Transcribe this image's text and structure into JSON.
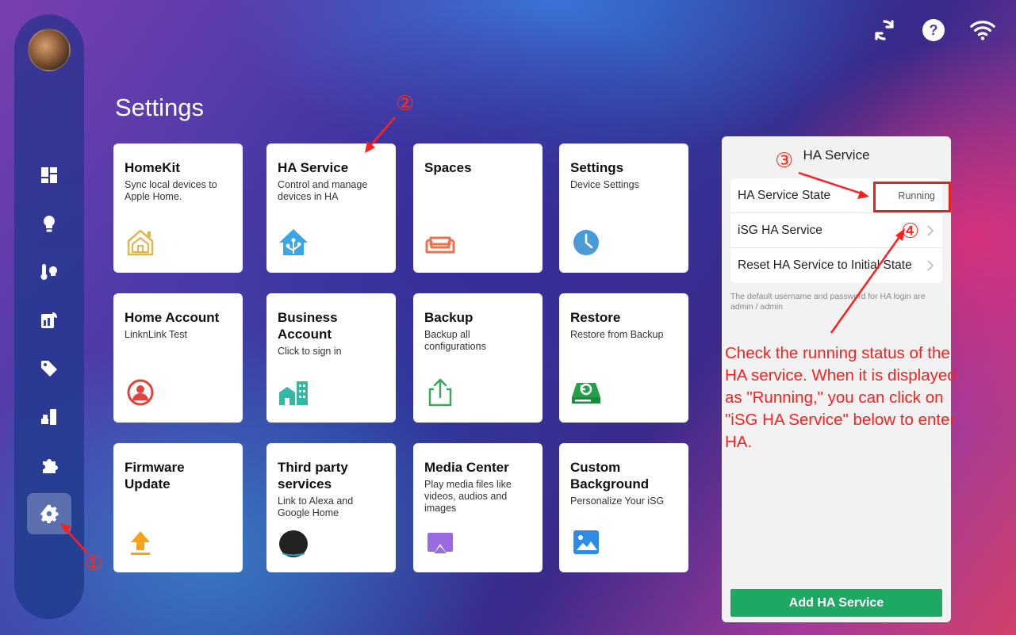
{
  "top_icons": [
    "sync-icon",
    "help-icon",
    "wifi-icon"
  ],
  "sidebar": {
    "items": [
      {
        "name": "dashboard-icon"
      },
      {
        "name": "lightbulb-icon"
      },
      {
        "name": "climate-icon"
      },
      {
        "name": "energy-icon"
      },
      {
        "name": "tag-icon"
      },
      {
        "name": "scene-icon"
      },
      {
        "name": "puzzle-icon"
      },
      {
        "name": "settings-gear-icon",
        "active": true
      }
    ]
  },
  "page": {
    "title": "Settings"
  },
  "cards": [
    {
      "id": "homekit",
      "title": "HomeKit",
      "subtitle": "Sync local devices to Apple Home.",
      "icon": "home-outline-icon",
      "color": "#e2b64a"
    },
    {
      "id": "ha-service",
      "title": "HA Service",
      "subtitle": "Control and manage devices in HA",
      "icon": "home-assistant-icon",
      "color": "#3ba6e6"
    },
    {
      "id": "spaces",
      "title": "Spaces",
      "subtitle": "",
      "icon": "sofa-icon",
      "color": "#e8734e"
    },
    {
      "id": "settings",
      "title": "Settings",
      "subtitle": "Device Settings",
      "icon": "clock-icon",
      "color": "#4a9ad8"
    },
    {
      "id": "home-account",
      "title": "Home Account",
      "subtitle": "LinknLink Test",
      "icon": "user-circle-icon",
      "color": "#e0443a"
    },
    {
      "id": "business-account",
      "title": "Business Account",
      "subtitle": "Click to sign in",
      "icon": "buildings-icon",
      "color": "#35b7a6"
    },
    {
      "id": "backup",
      "title": "Backup",
      "subtitle": "Backup all configurations",
      "icon": "upload-share-icon",
      "color": "#3aa85a"
    },
    {
      "id": "restore",
      "title": "Restore",
      "subtitle": "Restore from Backup",
      "icon": "restore-drive-icon",
      "color": "#24a04a"
    },
    {
      "id": "firmware-update",
      "title": "Firmware Update",
      "subtitle": "",
      "icon": "arrow-up-icon",
      "color": "#f5a31a"
    },
    {
      "id": "third-party",
      "title": "Third party services",
      "subtitle": "Link to Alexa and Google Home",
      "icon": "echo-speaker-icon",
      "color": "#222222"
    },
    {
      "id": "media-center",
      "title": "Media Center",
      "subtitle": "Play media files like videos, audios and images",
      "icon": "cast-icon",
      "color": "#9a6ae0"
    },
    {
      "id": "custom-background",
      "title": "Custom Background",
      "subtitle": "Personalize Your iSG",
      "icon": "image-icon",
      "color": "#2e8be6"
    }
  ],
  "panel": {
    "title": "HA Service",
    "rows": [
      {
        "label": "HA Service State",
        "value": "Running"
      },
      {
        "label": "iSG HA Service",
        "chevron": true
      },
      {
        "label": "Reset HA Service to Initial State",
        "chevron": true
      }
    ],
    "note": "The default username and password for HA login are admin / admin",
    "button": "Add HA Service"
  },
  "annotations": {
    "step1": "①",
    "step2": "②",
    "step3": "③",
    "step4": "④",
    "text": "Check the running status of the HA service. When it is displayed as \"Running,\" you can click on \"iSG HA Service\" below to enter HA."
  },
  "colors": {
    "accent_green": "#1da863",
    "annotation_red": "#ff1e1e"
  }
}
